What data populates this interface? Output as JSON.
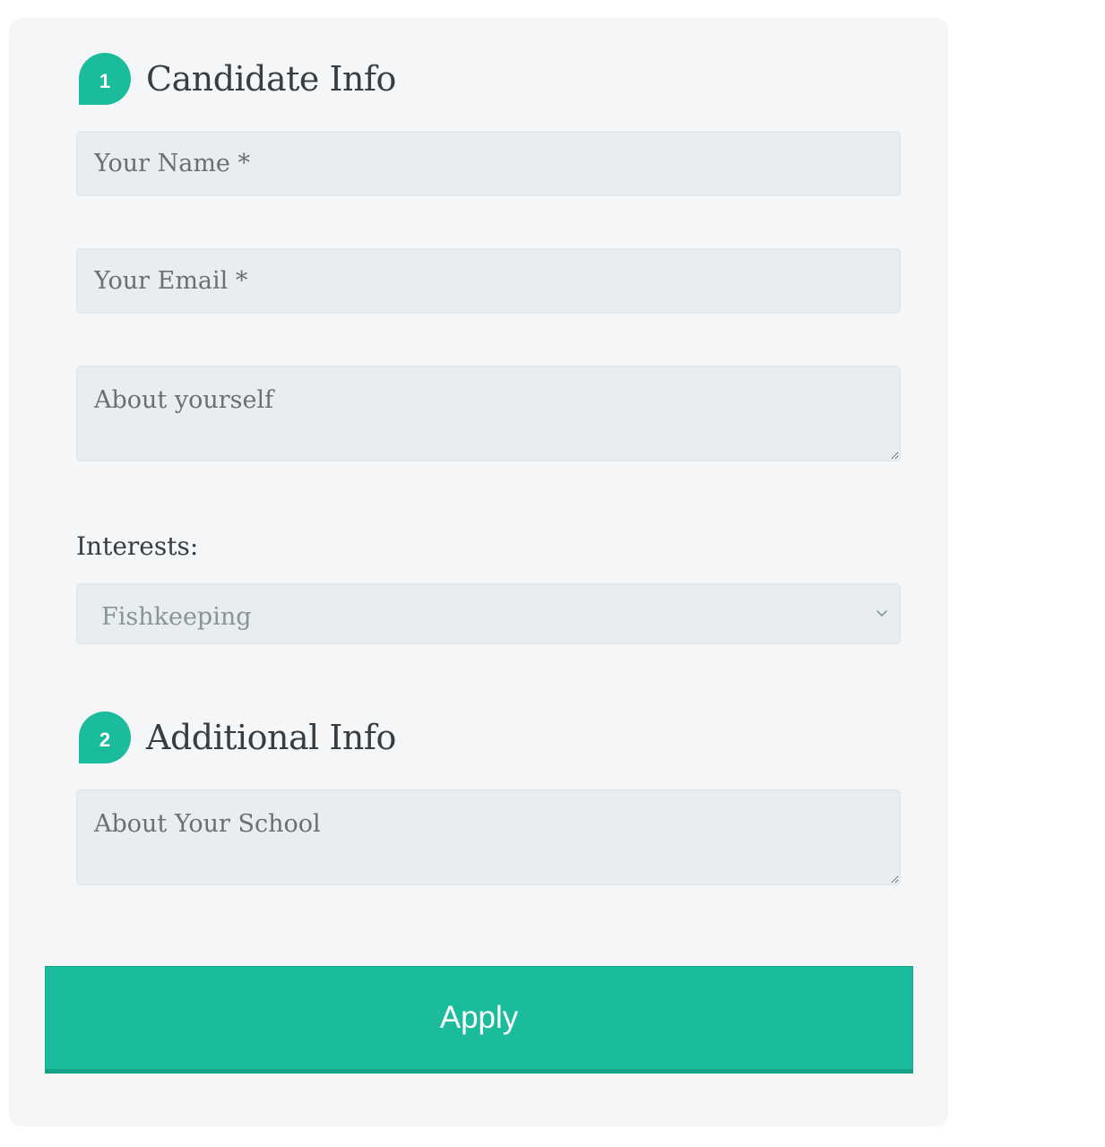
{
  "sections": [
    {
      "step": "1",
      "title": "Candidate Info"
    },
    {
      "step": "2",
      "title": "Additional Info"
    }
  ],
  "fields": {
    "name_placeholder": "Your Name *",
    "email_placeholder": "Your Email *",
    "about_placeholder": "About yourself",
    "school_placeholder": "About Your School"
  },
  "interests": {
    "label": "Interests:",
    "selected": "Fishkeeping"
  },
  "submit": {
    "label": "Apply"
  },
  "colors": {
    "accent": "#1bbc9b",
    "card_background": "#f4f6f8",
    "field_background": "#e8edef"
  },
  "icons": {
    "select_chevron": "chevron-down-icon",
    "resize_handle": "resize-grip-icon"
  }
}
